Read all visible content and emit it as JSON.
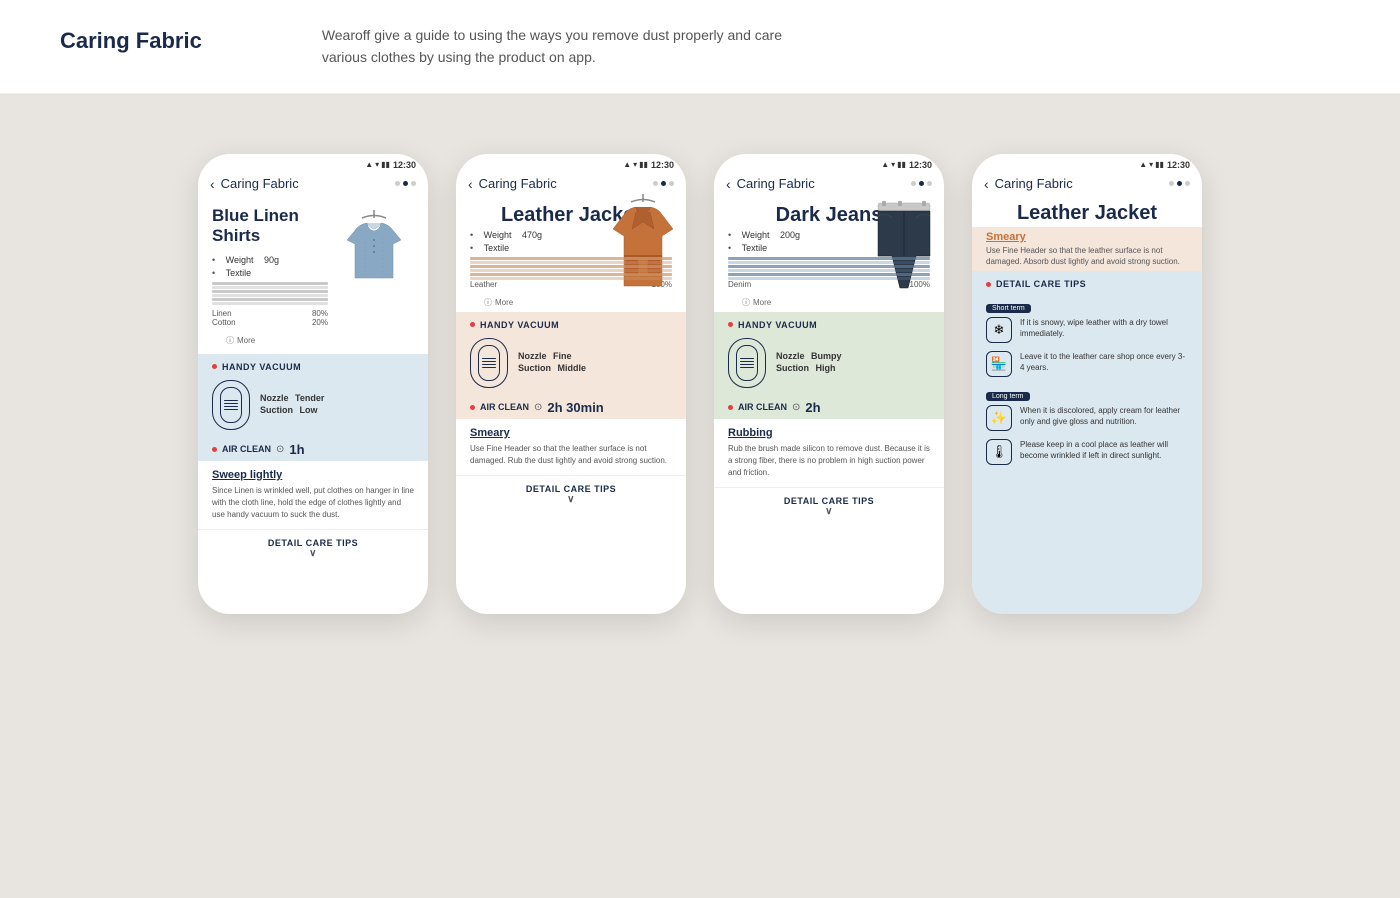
{
  "header": {
    "title": "Caring Fabric",
    "description": "Wearoff give a guide to using the ways you remove dust properly and care various clothes by using the product on app."
  },
  "phones": [
    {
      "id": "phone1",
      "status_time": "12:30",
      "app_title": "Caring Fabric",
      "garment_name": "Blue Linen Shirts",
      "weight": "90g",
      "textile": "Linen",
      "textile_detail": "Linen 80%, Cotton 20%",
      "more": "More",
      "vacuum_section": "HANDY VACUUM",
      "nozzle": "Tender",
      "suction": "Low",
      "air_clean": "AIR CLEAN",
      "air_time": "1h",
      "method_title": "Sweep lightly",
      "method_desc": "Since Linen is wrinkled well, put clothes on hanger in line with the cloth line, hold the edge of clothes lightly and use handy vacuum to suck the dust.",
      "detail_care": "DETAIL CARE TIPS",
      "bg_class": "blue"
    },
    {
      "id": "phone2",
      "status_time": "12:30",
      "app_title": "Caring Fabric",
      "garment_name": "Leather Jacket",
      "weight": "470g",
      "textile": "Leather",
      "textile_detail": "Leather 100%",
      "more": "More",
      "vacuum_section": "HANDY VACUUM",
      "nozzle": "Fine",
      "suction": "Middle",
      "air_clean": "AIR CLEAN",
      "air_time": "2h 30min",
      "method_title": "Smeary",
      "method_desc": "Use Fine Header so that the leather surface is not damaged. Rub the dust lightly and avoid strong suction.",
      "detail_care": "DETAIL CARE TIPS",
      "bg_class": "peach"
    },
    {
      "id": "phone3",
      "status_time": "12:30",
      "app_title": "Caring Fabric",
      "garment_name": "Dark Jeans",
      "weight": "200g",
      "textile": "Denim",
      "textile_detail": "Denim 100%",
      "more": "More",
      "vacuum_section": "HANDY VACUUM",
      "nozzle": "Bumpy",
      "suction": "High",
      "air_clean": "AIR CLEAN",
      "air_time": "2h",
      "method_title": "Rubbing",
      "method_desc": "Rub the brush made silicon to remove dust. Because it is a strong fiber, there is no problem in high suction power and friction.",
      "detail_care": "DETAIL CARE TIPS",
      "bg_class": "green"
    },
    {
      "id": "phone4",
      "status_time": "12:30",
      "app_title": "Caring Fabric",
      "garment_name": "Leather Jacket",
      "smeary_label": "Smeary",
      "smeary_desc": "Use Fine Header so that the leather surface is not damaged. Absorb dust lightly and avoid strong suction.",
      "detail_care_label": "DETAIL CARE TIPS",
      "short_term_badge": "Short term",
      "long_term_badge": "Long term",
      "tips": [
        {
          "icon": "❄️",
          "text": "If it is snowy, wipe leather with a dry towel immediately."
        },
        {
          "icon": "🏠",
          "text": "Leave it to the leather care shop once every 3-4 years."
        },
        {
          "icon": "✨",
          "text": "When it is discolored, apply cream for leather only and give gloss and nutrition."
        },
        {
          "icon": "🌡️",
          "text": "Please keep in a cool place as leather will become wrinkled if left in direct sunlight."
        }
      ]
    }
  ],
  "labels": {
    "weight": "Weight",
    "textile": "Textile",
    "nozzle": "Nozzle",
    "suction": "Suction",
    "more_icon": "ⓘ",
    "back_arrow": "‹",
    "clock": "⊙",
    "down_arrow": "∨",
    "red_dot": "●"
  }
}
